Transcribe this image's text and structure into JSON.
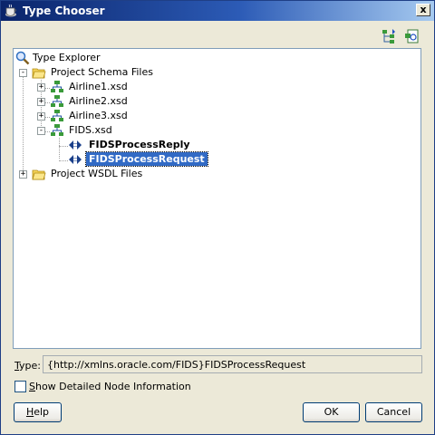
{
  "window": {
    "title": "Type Chooser",
    "close_label": "x"
  },
  "toolbar": {
    "icons": [
      "hierarchy-toggle-icon",
      "import-schema-icon"
    ]
  },
  "tree": {
    "root": "Type Explorer",
    "project_schema_files": "Project Schema Files",
    "airline1": "Airline1.xsd",
    "airline2": "Airline2.xsd",
    "airline3": "Airline3.xsd",
    "fids": "FIDS.xsd",
    "fids_reply": "FIDSProcessReply",
    "fids_request": "FIDSProcessRequest",
    "project_wsdl_files": "Project WSDL Files",
    "selected": "FIDSProcessRequest"
  },
  "type_field": {
    "label_mnemonic": "T",
    "label_rest": "ype:",
    "value": "{http://xmlns.oracle.com/FIDS}FIDSProcessRequest"
  },
  "show_detail": {
    "mnemonic": "S",
    "rest": "how Detailed Node Information",
    "checked": false
  },
  "buttons": {
    "help_mnemonic": "H",
    "help_rest": "elp",
    "ok": "OK",
    "cancel": "Cancel"
  },
  "colors": {
    "title_start": "#0a246a",
    "title_end": "#a6caf0",
    "selection": "#316ac5",
    "dialog_bg": "#ece9d8"
  }
}
